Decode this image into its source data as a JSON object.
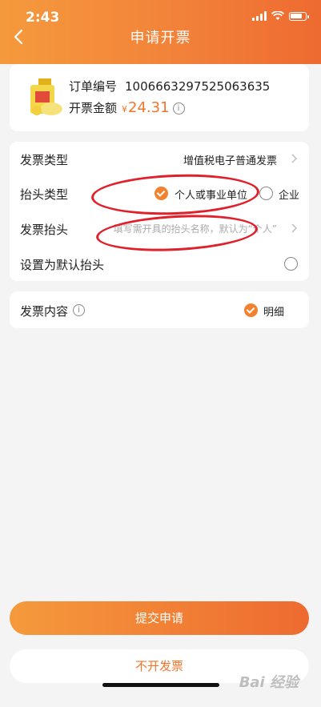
{
  "status_bar": {
    "time": "2:43"
  },
  "header": {
    "title": "申请开票"
  },
  "order": {
    "number_label": "订单编号",
    "number": "1006663297525063635",
    "amount_label": "开票金额",
    "currency": "¥",
    "amount": "24.31"
  },
  "form": {
    "invoice_type": {
      "label": "发票类型",
      "value": "增值税电子普通发票"
    },
    "header_type": {
      "label": "抬头类型",
      "options": [
        {
          "label": "个人或事业单位",
          "selected": true
        },
        {
          "label": "企业",
          "selected": false
        }
      ]
    },
    "invoice_title": {
      "label": "发票抬头",
      "placeholder": "填写需开具的抬头名称，默认为“个人”"
    },
    "default_title": {
      "label": "设置为默认抬头"
    }
  },
  "content": {
    "label": "发票内容",
    "option": "明细"
  },
  "buttons": {
    "submit": "提交申请",
    "no_invoice": "不开发票"
  },
  "watermark": "Bai 经验",
  "colors": {
    "accent": "#f2822f",
    "annotation": "#e0202a"
  }
}
